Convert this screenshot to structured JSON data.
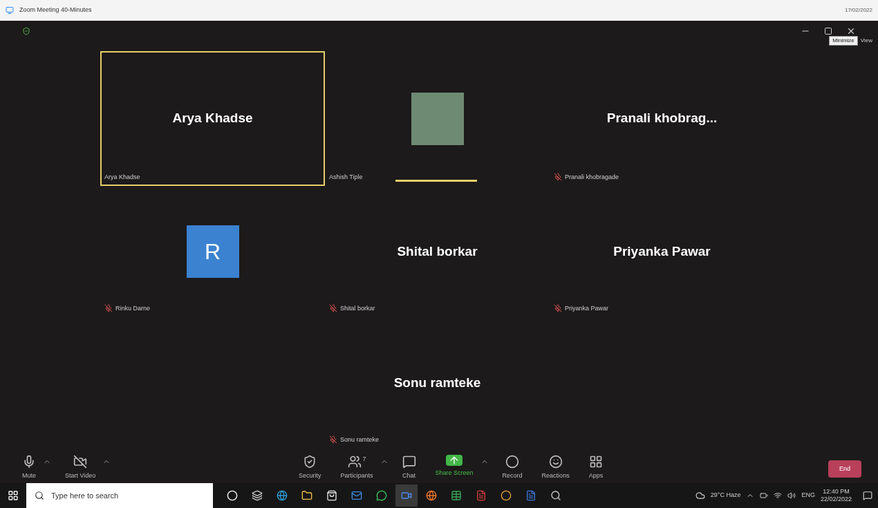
{
  "window": {
    "title": "Zoom Meeting 40-Minutes",
    "corner_date": "17/02/2022",
    "tooltip": "Minimize",
    "view_button": "View"
  },
  "tiles": [
    {
      "kind": "name",
      "display": "Arya Khadse",
      "label": "Arya Khadse",
      "muted": false,
      "active_border": true
    },
    {
      "kind": "photo",
      "label": "Ashish Tiple",
      "muted": false,
      "speaking_bar": true
    },
    {
      "kind": "name",
      "display": "Pranali khobrag...",
      "label": "Pranali khobragade",
      "muted": true
    },
    {
      "kind": "initial",
      "display": "R",
      "label": "Rinku Darne",
      "muted": true
    },
    {
      "kind": "name",
      "display": "Shital borkar",
      "label": "Shital borkar",
      "muted": true
    },
    {
      "kind": "name",
      "display": "Priyanka Pawar",
      "label": "Priyanka Pawar",
      "muted": true
    },
    {
      "kind": "empty"
    },
    {
      "kind": "name",
      "display": "Sonu ramteke",
      "label": "Sonu ramteke",
      "muted": true
    },
    {
      "kind": "empty"
    }
  ],
  "toolbar": {
    "left": [
      {
        "kind": "mic",
        "label": "Mute",
        "caret": true
      },
      {
        "kind": "video",
        "label": "Start Video",
        "caret": true
      }
    ],
    "center": [
      {
        "kind": "security",
        "label": "Security"
      },
      {
        "kind": "participants",
        "label": "Participants",
        "count": "7",
        "caret": true
      },
      {
        "kind": "chat",
        "label": "Chat"
      },
      {
        "kind": "share",
        "label": "Share Screen",
        "caret": true
      },
      {
        "kind": "record",
        "label": "Record"
      },
      {
        "kind": "reactions",
        "label": "Reactions"
      },
      {
        "kind": "apps",
        "label": "Apps"
      }
    ],
    "end_button": "End"
  },
  "taskbar": {
    "search": {
      "placeholder": "Type here to search"
    },
    "apps": [
      {
        "kind": "cortana",
        "selected": false
      },
      {
        "kind": "taskview",
        "selected": false
      },
      {
        "kind": "edge",
        "selected": false
      },
      {
        "kind": "folder",
        "selected": false
      },
      {
        "kind": "store",
        "selected": false
      },
      {
        "kind": "mail",
        "selected": false
      },
      {
        "kind": "whatsapp",
        "selected": false
      },
      {
        "kind": "zoom",
        "selected": true
      },
      {
        "kind": "firefox",
        "selected": false
      },
      {
        "kind": "excel",
        "selected": false
      },
      {
        "kind": "pdf",
        "selected": false
      },
      {
        "kind": "chrome",
        "selected": false
      },
      {
        "kind": "word",
        "selected": false
      },
      {
        "kind": "search",
        "selected": false
      }
    ],
    "weather": "29°C  Haze",
    "language": "ENG",
    "time": "12:40 PM",
    "date": "22/02/2022"
  }
}
